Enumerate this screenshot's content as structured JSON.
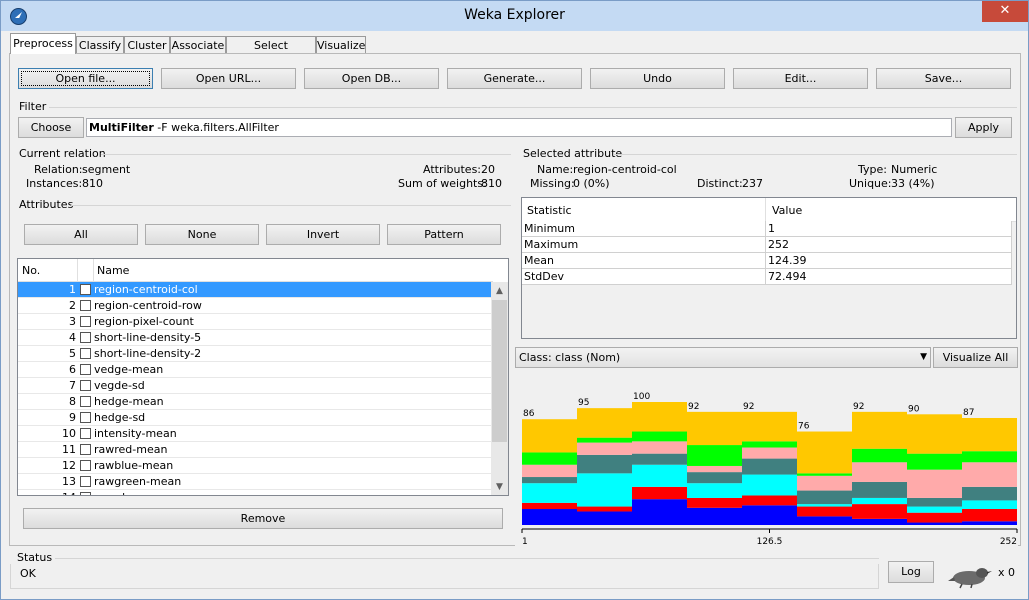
{
  "window": {
    "title": "Weka Explorer",
    "close_glyph": "✕"
  },
  "tabs": [
    {
      "label": "Preprocess",
      "active": true
    },
    {
      "label": "Classify",
      "active": false
    },
    {
      "label": "Cluster",
      "active": false
    },
    {
      "label": "Associate",
      "active": false
    },
    {
      "label": "Select attributes",
      "active": false
    },
    {
      "label": "Visualize",
      "active": false
    }
  ],
  "toolbar": {
    "open_file": "Open file...",
    "open_url": "Open URL...",
    "open_db": "Open DB...",
    "generate": "Generate...",
    "undo": "Undo",
    "edit": "Edit...",
    "save": "Save..."
  },
  "filter": {
    "section_label": "Filter",
    "choose_label": "Choose",
    "filter_name": "MultiFilter",
    "filter_args": " -F weka.filters.AllFilter",
    "apply_label": "Apply"
  },
  "current_relation": {
    "section_label": "Current relation",
    "relation_label": "Relation:",
    "relation_value": "segment",
    "instances_label": "Instances:",
    "instances_value": "810",
    "attributes_label": "Attributes:",
    "attributes_value": "20",
    "sum_weights_label": "Sum of weights:",
    "sum_weights_value": "810"
  },
  "attributes": {
    "section_label": "Attributes",
    "all_label": "All",
    "none_label": "None",
    "invert_label": "Invert",
    "pattern_label": "Pattern",
    "col_no": "No.",
    "col_name": "Name",
    "remove_label": "Remove",
    "rows": [
      {
        "no": "1",
        "name": "region-centroid-col",
        "selected": true
      },
      {
        "no": "2",
        "name": "region-centroid-row",
        "selected": false
      },
      {
        "no": "3",
        "name": "region-pixel-count",
        "selected": false
      },
      {
        "no": "4",
        "name": "short-line-density-5",
        "selected": false
      },
      {
        "no": "5",
        "name": "short-line-density-2",
        "selected": false
      },
      {
        "no": "6",
        "name": "vedge-mean",
        "selected": false
      },
      {
        "no": "7",
        "name": "vegde-sd",
        "selected": false
      },
      {
        "no": "8",
        "name": "hedge-mean",
        "selected": false
      },
      {
        "no": "9",
        "name": "hedge-sd",
        "selected": false
      },
      {
        "no": "10",
        "name": "intensity-mean",
        "selected": false
      },
      {
        "no": "11",
        "name": "rawred-mean",
        "selected": false
      },
      {
        "no": "12",
        "name": "rawblue-mean",
        "selected": false
      },
      {
        "no": "13",
        "name": "rawgreen-mean",
        "selected": false
      },
      {
        "no": "14",
        "name": "exred-mean",
        "selected": false
      }
    ]
  },
  "selected_attribute": {
    "section_label": "Selected attribute",
    "name_label": "Name:",
    "name_value": "region-centroid-col",
    "type_label": "Type:",
    "type_value": "Numeric",
    "missing_label": "Missing:",
    "missing_value": "0 (0%)",
    "distinct_label": "Distinct:",
    "distinct_value": "237",
    "unique_label": "Unique:",
    "unique_value": "33 (4%)",
    "stats_header": [
      "Statistic",
      "Value"
    ],
    "stats": [
      [
        "Minimum",
        "1"
      ],
      [
        "Maximum",
        "252"
      ],
      [
        "Mean",
        "124.39"
      ],
      [
        "StdDev",
        "72.494"
      ]
    ]
  },
  "class_select": {
    "value": "Class: class (Nom)",
    "visualize_all": "Visualize All"
  },
  "chart_data": {
    "type": "bar",
    "stacked": true,
    "x_ticks": [
      "1",
      "126.5",
      "252"
    ],
    "bin_counts": [
      "86",
      "95",
      "100",
      "92",
      "92",
      "76",
      "92",
      "90",
      "87"
    ],
    "totals": [
      86,
      95,
      100,
      92,
      92,
      76,
      92,
      90,
      87
    ],
    "series": [
      {
        "color": "#0000ff",
        "values": [
          13,
          11,
          21,
          14,
          16,
          7,
          5,
          2,
          3
        ]
      },
      {
        "color": "#ff0000",
        "values": [
          5,
          4,
          10,
          8,
          8,
          8,
          12,
          8,
          10
        ]
      },
      {
        "color": "#00ffff",
        "values": [
          16,
          27,
          18,
          12,
          17,
          2,
          5,
          5,
          7
        ]
      },
      {
        "color": "#408080",
        "values": [
          5,
          15,
          9,
          9,
          13,
          11,
          13,
          7,
          11
        ]
      },
      {
        "color": "#ffaaaa",
        "values": [
          10,
          10,
          10,
          5,
          9,
          12,
          16,
          23,
          20
        ]
      },
      {
        "color": "#00ff00",
        "values": [
          10,
          4,
          8,
          17,
          5,
          2,
          11,
          13,
          9
        ]
      },
      {
        "color": "#ffc800",
        "values": [
          27,
          24,
          24,
          27,
          24,
          34,
          30,
          32,
          27
        ]
      }
    ]
  },
  "status": {
    "section_label": "Status",
    "text": "OK",
    "log_label": "Log",
    "count": "x 0",
    "bird_icon": "weka-bird-icon"
  }
}
